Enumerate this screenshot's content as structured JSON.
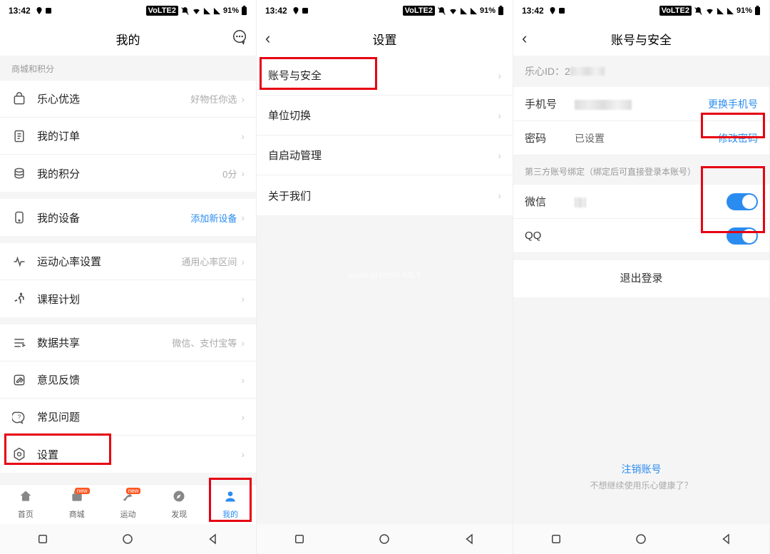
{
  "status": {
    "time": "13:42",
    "volte": "VoLTE2",
    "battery": "91%"
  },
  "screen1": {
    "title": "我的",
    "section_mall": "商城和积分",
    "rows": {
      "shop": {
        "label": "乐心优选",
        "value": "好物任你选"
      },
      "orders": {
        "label": "我的订单"
      },
      "points": {
        "label": "我的积分",
        "value": "0分"
      },
      "devices": {
        "label": "我的设备",
        "value": "添加新设备"
      },
      "hr": {
        "label": "运动心率设置",
        "value": "通用心率区间"
      },
      "course": {
        "label": "课程计划"
      },
      "share": {
        "label": "数据共享",
        "value": "微信、支付宝等"
      },
      "feedback": {
        "label": "意见反馈"
      },
      "faq": {
        "label": "常见问题"
      },
      "settings": {
        "label": "设置"
      }
    },
    "tabs": {
      "home": "首页",
      "mall": "商城",
      "sport": "运动",
      "discover": "发现",
      "mine": "我的",
      "badge_new": "new"
    }
  },
  "screen2": {
    "title": "设置",
    "rows": {
      "account": "账号与安全",
      "units": "单位切换",
      "autostart": "自启动管理",
      "about": "关于我们"
    },
    "watermark": "www.pHome.NET"
  },
  "screen3": {
    "title": "账号与安全",
    "id_label": "乐心ID：",
    "id_prefix": "2",
    "phone_label": "手机号",
    "phone_action": "更换手机号",
    "pwd_label": "密码",
    "pwd_value": "已设置",
    "pwd_action": "修改密码",
    "third_party_header": "第三方账号绑定（绑定后可直接登录本账号）",
    "wechat_label": "微信",
    "qq_label": "QQ",
    "logout": "退出登录",
    "cancel_title": "注销账号",
    "cancel_sub": "不想继续使用乐心健康了？"
  }
}
